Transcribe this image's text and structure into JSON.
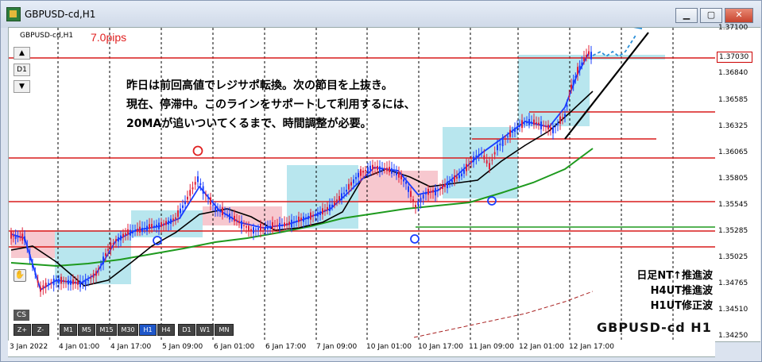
{
  "window": {
    "title": "GBPUSD-cd,H1",
    "minimize": "▁",
    "maximize": "▢",
    "close": "✕"
  },
  "chart": {
    "symbol_label": "GBPUSD-cd,H1",
    "pips_label": "7.0pips",
    "watermark": "GBPUSD-cd H1",
    "current_price": "1.37030",
    "annotation_lines": [
      "昨日は前回高値でレジサポ転換。次の節目を上抜き。",
      "現在、停滞中。このラインをサポートして利用するには、",
      "20MAが追いついてくるまで、時間調整が必要。"
    ],
    "wave_notes": [
      "日足NT↑推進波",
      "H4UT推進波",
      "H1UT修正波"
    ],
    "side_buttons": [
      "▲",
      "D1",
      "▼"
    ],
    "cs_label": "CS",
    "timeframes": [
      "Z+",
      "Z-",
      "M1",
      "M5",
      "M15",
      "M30",
      "H1",
      "H4",
      "D1",
      "W1",
      "MN"
    ],
    "active_timeframe": "H1",
    "price_ticks": [
      "1.37100",
      "1.36840",
      "1.36585",
      "1.36325",
      "1.36065",
      "1.35805",
      "1.35545",
      "1.35285",
      "1.35025",
      "1.34765",
      "1.34510",
      "1.34250"
    ],
    "time_ticks": [
      "3 Jan 2022",
      "4 Jan 01:00",
      "4 Jan 17:00",
      "5 Jan 09:00",
      "6 Jan 01:00",
      "6 Jan 17:00",
      "7 Jan 09:00",
      "10 Jan 01:00",
      "10 Jan 17:00",
      "11 Jan 09:00",
      "12 Jan 01:00",
      "12 Jan 17:00"
    ],
    "colors": {
      "bull_candle": "#1a3dff",
      "bear_candle": "#e0203a",
      "ma20": "#000000",
      "ma_long": "#1e9a1e",
      "level_line": "#d81c1c",
      "box_blue": "#b8e6ee",
      "box_pink": "#f7c8cf"
    }
  }
}
